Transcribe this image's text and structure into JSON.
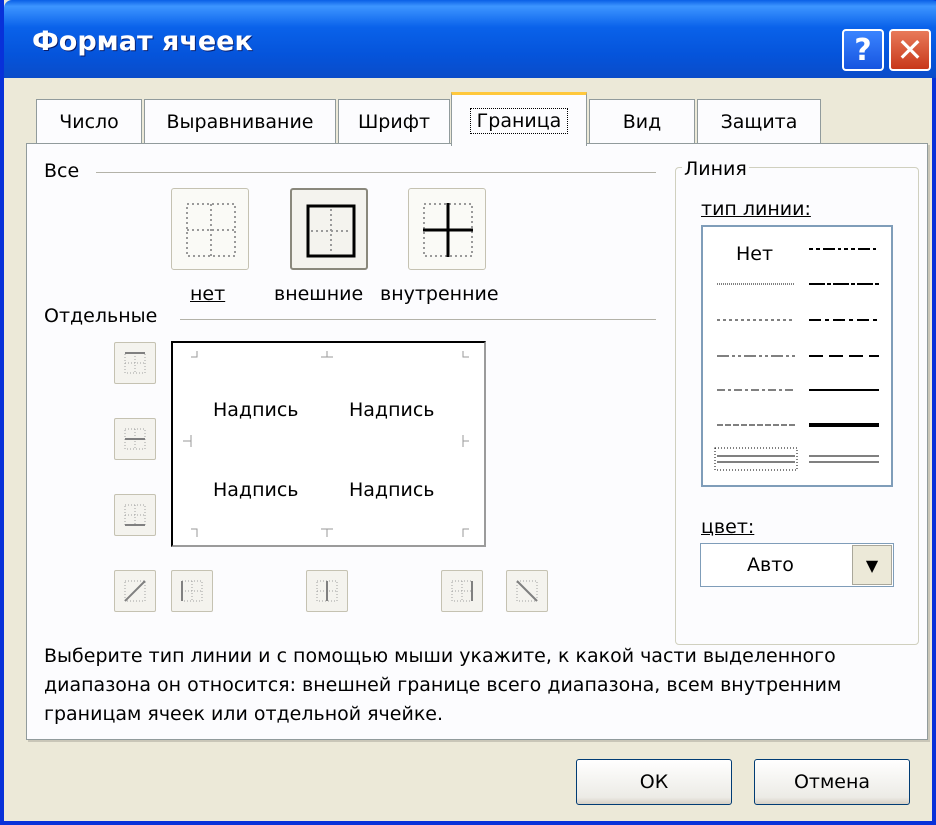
{
  "window": {
    "title": "Формат ячеек",
    "help_glyph": "?",
    "close_glyph": "✕"
  },
  "tabs": [
    {
      "label": "Число"
    },
    {
      "label": "Выравнивание"
    },
    {
      "label": "Шрифт"
    },
    {
      "label": "Граница",
      "active": true
    },
    {
      "label": "Вид"
    },
    {
      "label": "Защита"
    }
  ],
  "all_section": {
    "title": "Все",
    "presets": [
      {
        "label": "нет",
        "icon": "no-border-icon"
      },
      {
        "label": "внешние",
        "icon": "outline-border-icon"
      },
      {
        "label": "внутренние",
        "icon": "inside-border-icon"
      }
    ]
  },
  "individual_section": {
    "title": "Отдельные",
    "preview_cells": [
      "Надпись",
      "Надпись",
      "Надпись",
      "Надпись"
    ]
  },
  "line_section": {
    "title": "Линия",
    "type_label": "тип линии:",
    "none_label": "Нет",
    "color_label": "цвет:",
    "color_value": "Авто"
  },
  "description": "Выберите тип линии и с помощью мыши укажите, к какой части выделенного диапазона он относится: внешней границе всего диапазона, всем внутренним границам ячеек или отдельной ячейке.",
  "buttons": {
    "ok": "ОК",
    "cancel": "Отмена"
  },
  "colors": {
    "titlebar": "#0a5fe6",
    "dialog_bg": "#ece9d8",
    "tab_active_accent": "#ffc83c"
  }
}
